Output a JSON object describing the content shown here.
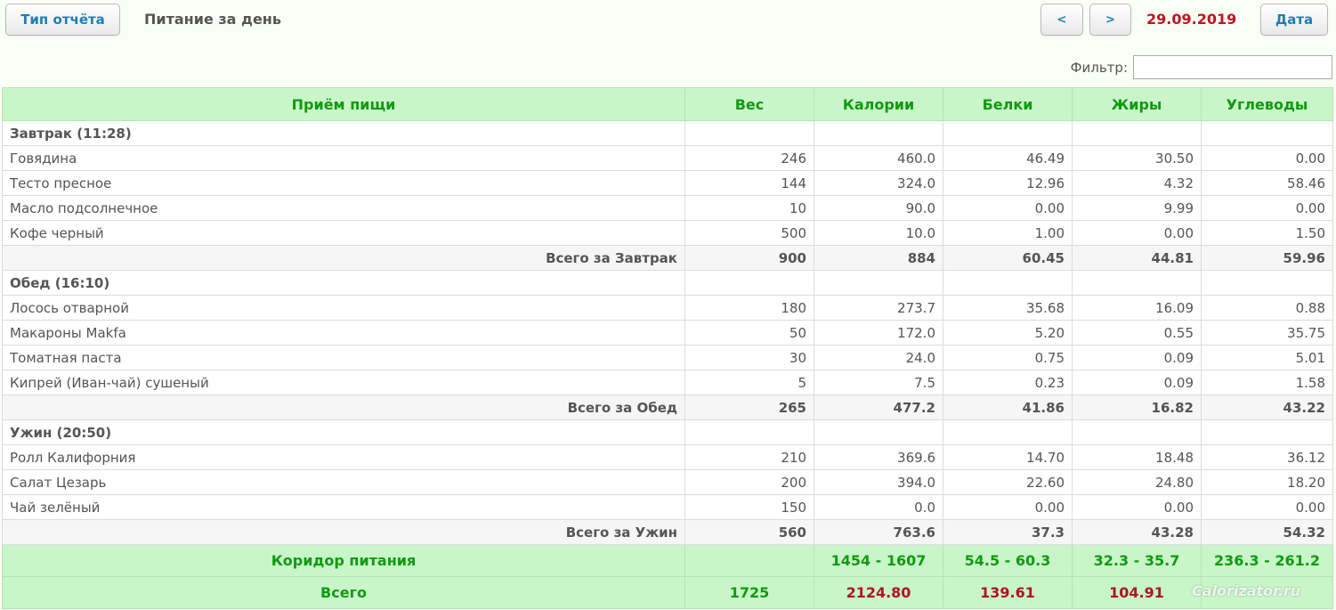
{
  "toolbar": {
    "report_type_label": "Тип отчёта",
    "page_title": "Питание за день",
    "prev_label": "<",
    "next_label": ">",
    "current_date": "29.09.2019",
    "date_label": "Дата"
  },
  "filter": {
    "label": "Фильтр:",
    "value": "",
    "placeholder": ""
  },
  "table": {
    "columns": [
      "Приём пищи",
      "Вес",
      "Калории",
      "Белки",
      "Жиры",
      "Углеводы"
    ],
    "meals": [
      {
        "title": "Завтрак (11:28)",
        "items": [
          [
            "Говядина",
            "246",
            "460.0",
            "46.49",
            "30.50",
            "0.00"
          ],
          [
            "Тесто пресное",
            "144",
            "324.0",
            "12.96",
            "4.32",
            "58.46"
          ],
          [
            "Масло подсолнечное",
            "10",
            "90.0",
            "0.00",
            "9.99",
            "0.00"
          ],
          [
            "Кофе черный",
            "500",
            "10.0",
            "1.00",
            "0.00",
            "1.50"
          ]
        ],
        "total": [
          "Всего за Завтрак",
          "900",
          "884",
          "60.45",
          "44.81",
          "59.96"
        ]
      },
      {
        "title": "Обед (16:10)",
        "items": [
          [
            "Лосось отварной",
            "180",
            "273.7",
            "35.68",
            "16.09",
            "0.88"
          ],
          [
            "Макароны Makfa",
            "50",
            "172.0",
            "5.20",
            "0.55",
            "35.75"
          ],
          [
            "Томатная паста",
            "30",
            "24.0",
            "0.75",
            "0.09",
            "5.01"
          ],
          [
            "Кипрей (Иван-чай) сушеный",
            "5",
            "7.5",
            "0.23",
            "0.09",
            "1.58"
          ]
        ],
        "total": [
          "Всего за Обед",
          "265",
          "477.2",
          "41.86",
          "16.82",
          "43.22"
        ]
      },
      {
        "title": "Ужин (20:50)",
        "items": [
          [
            "Ролл Калифорния",
            "210",
            "369.6",
            "14.70",
            "18.48",
            "36.12"
          ],
          [
            "Салат Цезарь",
            "200",
            "394.0",
            "22.60",
            "24.80",
            "18.20"
          ],
          [
            "Чай зелёный",
            "150",
            "0.0",
            "0.00",
            "0.00",
            "0.00"
          ]
        ],
        "total": [
          "Всего за Ужин",
          "560",
          "763.6",
          "37.3",
          "43.28",
          "54.32"
        ]
      }
    ],
    "corridor": [
      "Коридор питания",
      "",
      "1454 - 1607",
      "54.5 - 60.3",
      "32.3 - 35.7",
      "236.3 - 261.2"
    ],
    "grand_total": [
      "Всего",
      "1725",
      "2124.80",
      "139.61",
      "104.91",
      ""
    ]
  },
  "watermark": "Calorizator.ru",
  "colors": {
    "accent_green": "#119a11",
    "header_bg": "#c9f6c9",
    "date_red": "#c0141e",
    "total_red": "#b01421",
    "button_text": "#1d7fb3"
  }
}
